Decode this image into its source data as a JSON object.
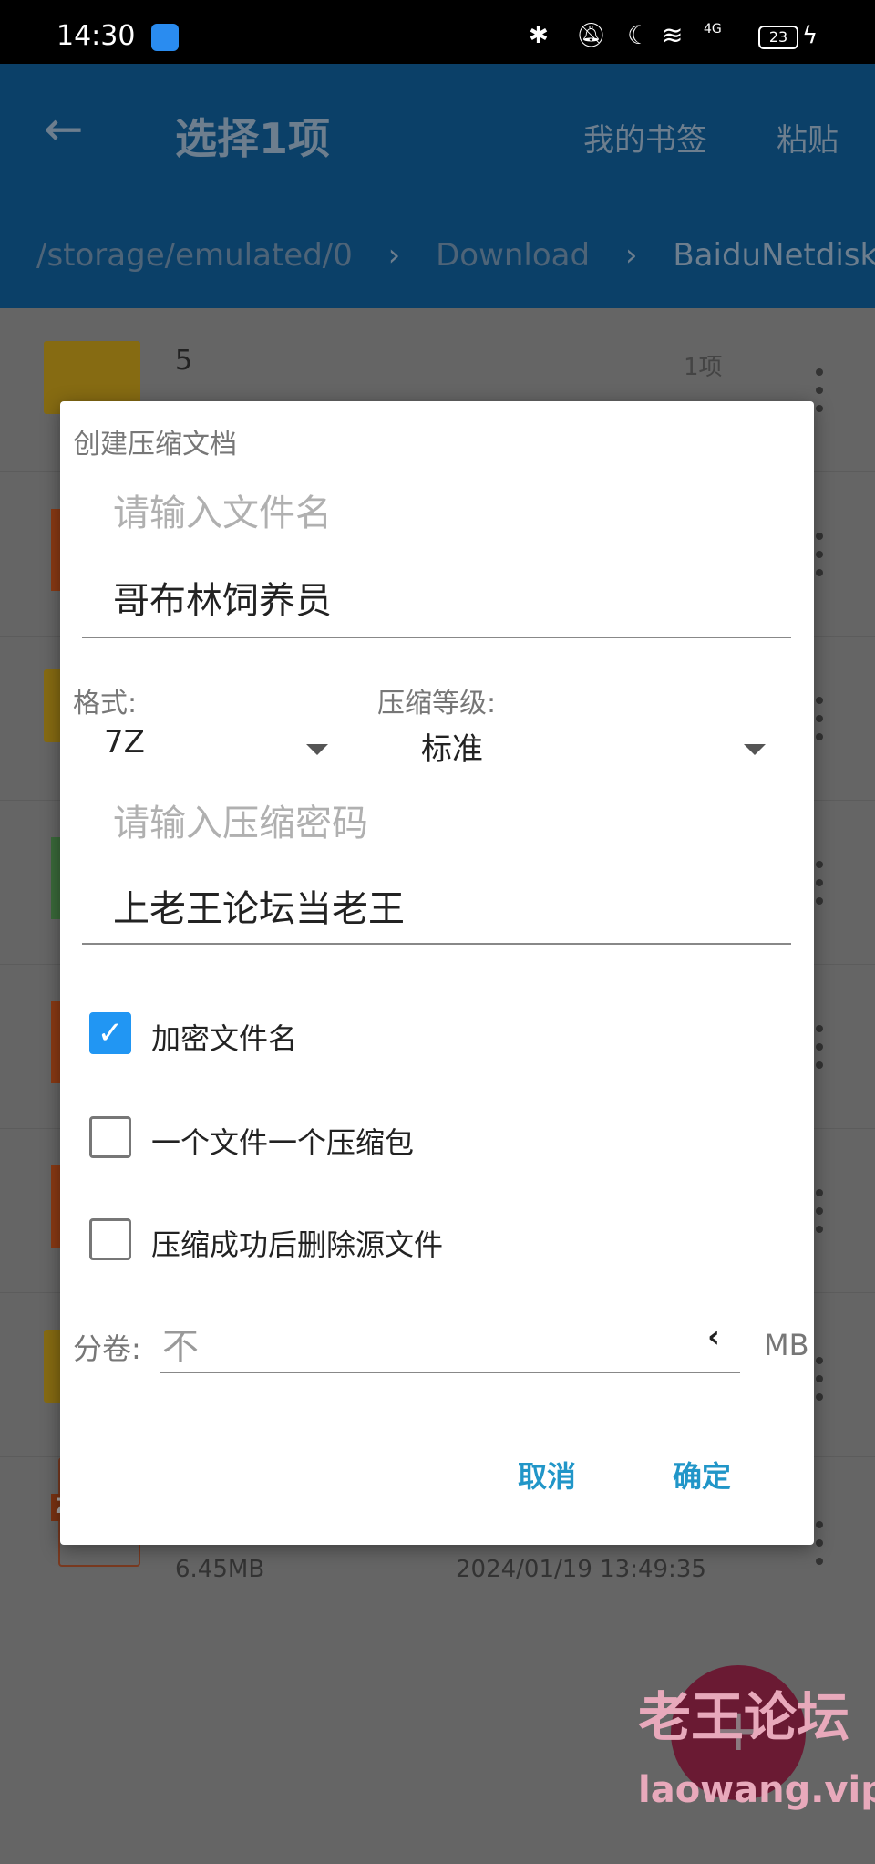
{
  "status_bar": {
    "time": "14:30",
    "battery": "23",
    "network": "4G"
  },
  "app_bar": {
    "title": "选择1项",
    "bookmarks": "我的书签",
    "paste": "粘贴"
  },
  "breadcrumb": [
    "/storage/emulated/0",
    "Download",
    "BaiduNetdisk"
  ],
  "file_list": [
    {
      "name": "5",
      "meta": "1项",
      "type": "folder"
    },
    {
      "type": "file"
    },
    {
      "type": "folder"
    },
    {
      "type": "file"
    },
    {
      "type": "file"
    },
    {
      "type": "file"
    },
    {
      "type": "folder"
    },
    {
      "type": "zip",
      "badge": "ZIP",
      "size": "6.45MB",
      "date": "2024/01/19 13:49:35"
    }
  ],
  "dialog": {
    "title": "创建压缩文档",
    "filename_placeholder": "请输入文件名",
    "filename_value": "哥布林饲养员",
    "format_label": "格式:",
    "format_value": "7Z",
    "level_label": "压缩等级:",
    "level_value": "标准",
    "password_placeholder": "请输入压缩密码",
    "password_value": "上老王论坛当老王",
    "options": [
      {
        "label": "加密文件名",
        "checked": true
      },
      {
        "label": "一个文件一个压缩包",
        "checked": false
      },
      {
        "label": "压缩成功后删除源文件",
        "checked": false
      }
    ],
    "split_label": "分卷:",
    "split_value": "不",
    "split_unit": "MB",
    "cancel": "取消",
    "ok": "确定"
  },
  "fab": {
    "icon": "plus-icon"
  },
  "watermark": {
    "title": "老王论坛",
    "url": "laowang.vip"
  },
  "colors": {
    "app_bar": "#1565a8",
    "accent": "#2196f3",
    "fab": "#e91e63"
  }
}
